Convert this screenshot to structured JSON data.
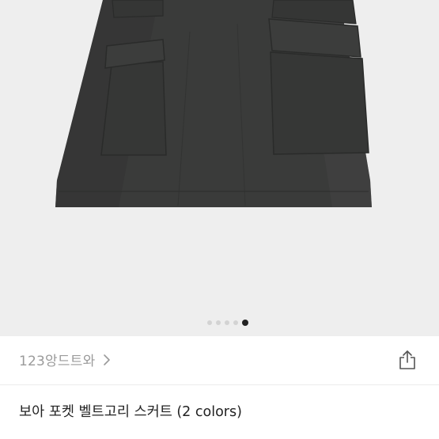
{
  "product": {
    "title": "보아 포켓 벨트고리 스커트 (2 colors)",
    "colors": {
      "image_background": "#eeeeee",
      "garment": "#3a3b3a"
    }
  },
  "carousel": {
    "total_images": 5,
    "current_index": 5
  },
  "shop": {
    "name": "123앙드트와",
    "chevron_icon": "chevron-right-icon"
  },
  "actions": {
    "share_icon": "share-icon"
  }
}
